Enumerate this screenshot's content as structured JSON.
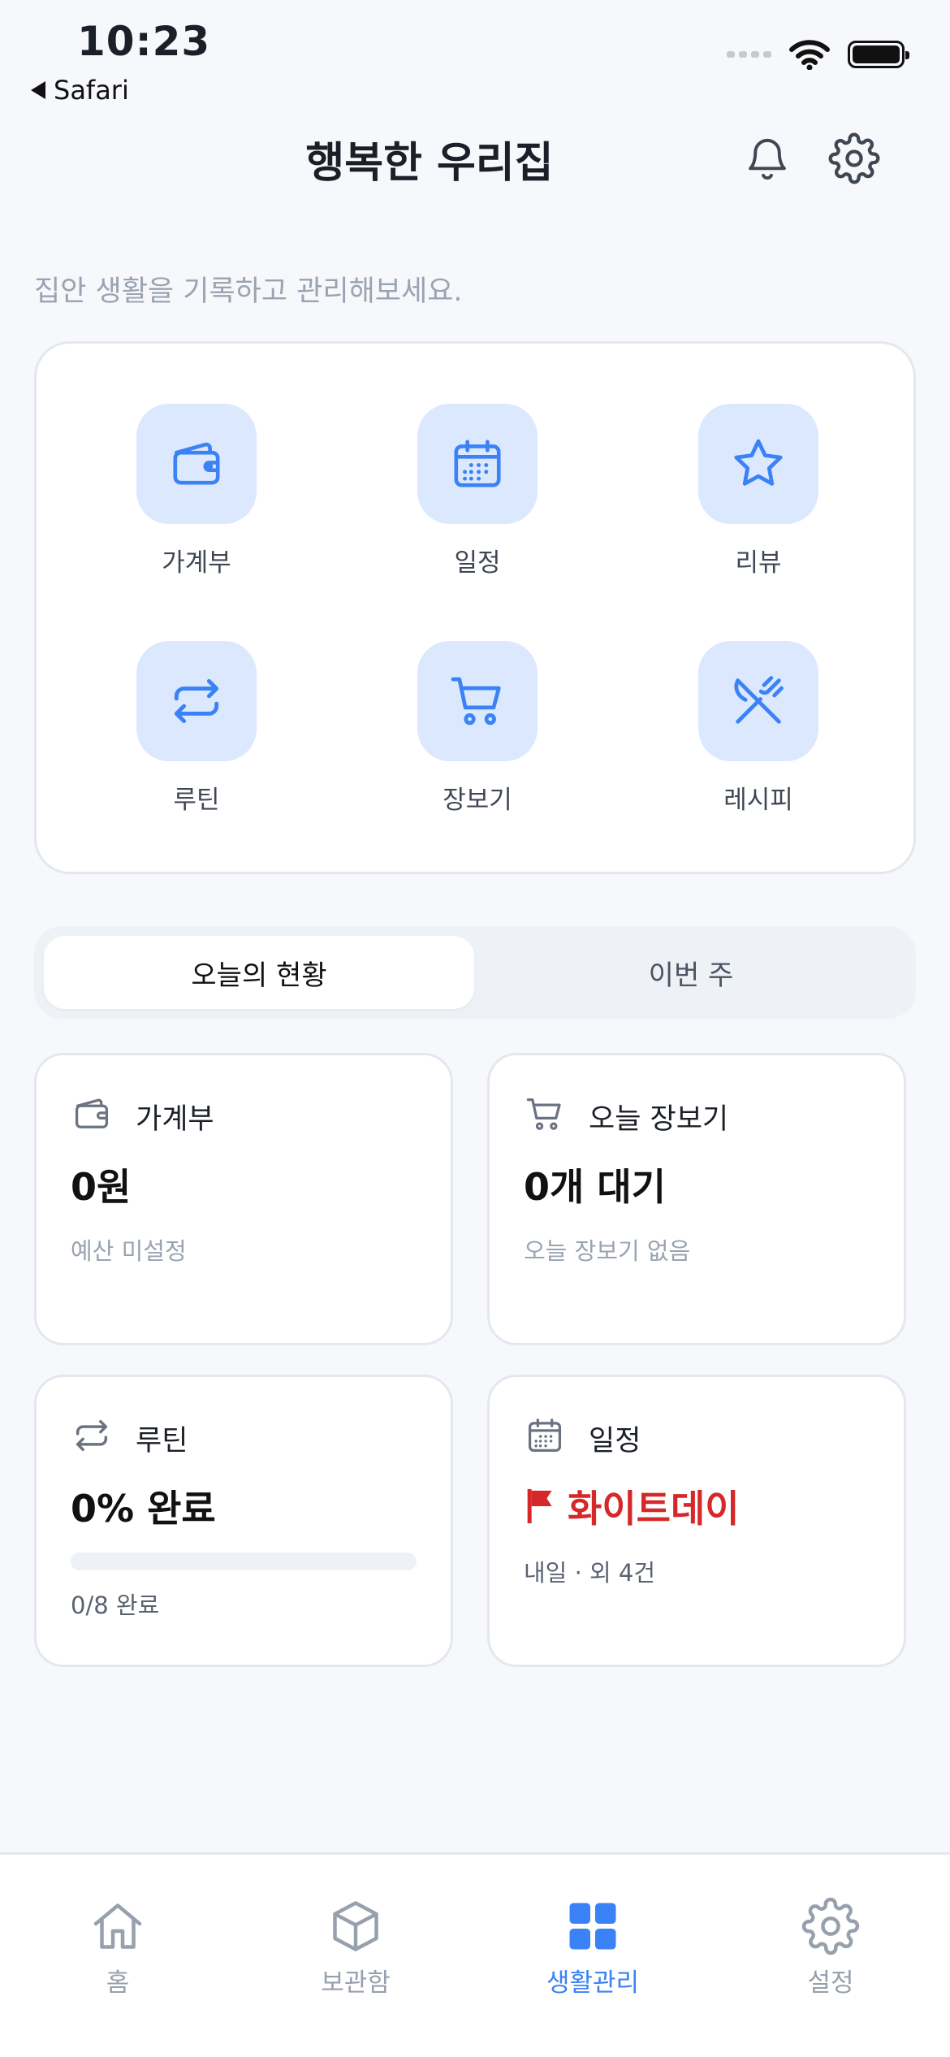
{
  "status_bar": {
    "time": "10:23",
    "back_label": "Safari"
  },
  "header": {
    "title": "행복한 우리집",
    "subtitle": "집안 생활을 기록하고 관리해보세요."
  },
  "quick_menu": [
    {
      "label": "가계부",
      "icon": "wallet-icon"
    },
    {
      "label": "일정",
      "icon": "calendar-icon"
    },
    {
      "label": "리뷰",
      "icon": "star-icon"
    },
    {
      "label": "루틴",
      "icon": "repeat-icon"
    },
    {
      "label": "장보기",
      "icon": "cart-icon"
    },
    {
      "label": "레시피",
      "icon": "utensils-icon"
    }
  ],
  "segment": {
    "active": "오늘의 현황",
    "inactive": "이번 주"
  },
  "cards": {
    "budget": {
      "title": "가계부",
      "value": "0원",
      "sub": "예산 미설정"
    },
    "shopping": {
      "title": "오늘 장보기",
      "value": "0개 대기",
      "sub": "오늘 장보기 없음"
    },
    "routine": {
      "title": "루틴",
      "value": "0% 완료",
      "progress": 0,
      "sub": "0/8 완료"
    },
    "schedule": {
      "title": "일정",
      "value": "화이트데이",
      "sub": "내일 · 외 4건"
    }
  },
  "tabs": [
    {
      "label": "홈",
      "icon": "home-icon"
    },
    {
      "label": "보관함",
      "icon": "box-icon"
    },
    {
      "label": "생활관리",
      "icon": "grid-icon"
    },
    {
      "label": "설정",
      "icon": "gear-icon"
    }
  ],
  "colors": {
    "accent": "#3b82f6",
    "tile_bg": "#dbe8fe",
    "alert_red": "#d62828",
    "muted": "#9aa3b2"
  }
}
